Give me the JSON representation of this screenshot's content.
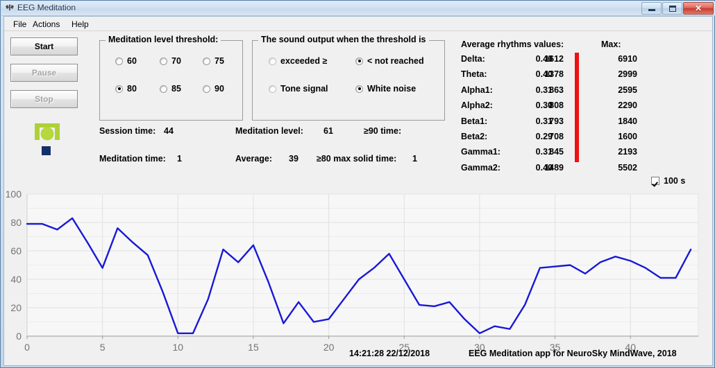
{
  "window": {
    "title": "EEG Meditation",
    "icon": "app-butterfly-icon",
    "buttons": {
      "minimize": "minimize",
      "maximize": "maximize",
      "close": "✕"
    }
  },
  "menu": {
    "items": [
      {
        "label": "File",
        "x": 8
      },
      {
        "label": "Actions",
        "x": 36
      },
      {
        "label": "Help",
        "x": 92
      }
    ]
  },
  "controls": {
    "start": "Start",
    "pause": "Pause",
    "stop": "Stop",
    "start_enabled": true,
    "pause_enabled": false,
    "stop_enabled": false
  },
  "threshold_group": {
    "legend": "Meditation level threshold:",
    "options": [
      {
        "label": "60",
        "selected": false
      },
      {
        "label": "70",
        "selected": false
      },
      {
        "label": "75",
        "selected": false
      },
      {
        "label": "80",
        "selected": true
      },
      {
        "label": "85",
        "selected": false
      },
      {
        "label": "90",
        "selected": false
      }
    ],
    "selected_value": "80"
  },
  "sound_group": {
    "legend": "The sound output when the threshold is",
    "options": [
      {
        "label": "exceeded ≥",
        "selected": false
      },
      {
        "label": "< not reached",
        "selected": true
      },
      {
        "label": "Tone signal",
        "selected": false
      },
      {
        "label": "White noise",
        "selected": true
      }
    ]
  },
  "signal": {
    "headset_icon": "headset-signal-icon",
    "headset_color": "#aed136",
    "status_square_icon": "connection-status-square",
    "status_color": "#14306b"
  },
  "stats": {
    "session_time_label": "Session time:",
    "session_time_value": "44",
    "meditation_time_label": "Meditation time:",
    "meditation_time_value": "1",
    "meditation_level_label": "Meditation level:",
    "meditation_level_value": "61",
    "average_label": "Average:",
    "average_value": "39",
    "ge90_time_label": "≥90 time:",
    "ge90_time_value": "",
    "ge80_solid_label": "≥80 max solid time:",
    "ge80_solid_value": "1"
  },
  "rhythms": {
    "header_avg": "Average rhythms values:",
    "header_max": "Max:",
    "separator_color": "#ee1111",
    "rows": [
      {
        "name": "Delta:",
        "ratio": "0.40",
        "value": "1612",
        "max": "6910"
      },
      {
        "name": "Theta:",
        "ratio": "0.40",
        "value": "1378",
        "max": "2999"
      },
      {
        "name": "Alpha1:",
        "ratio": "0.31",
        "value": "863",
        "max": "2595"
      },
      {
        "name": "Alpha2:",
        "ratio": "0.30",
        "value": "808",
        "max": "2290"
      },
      {
        "name": "Beta1:",
        "ratio": "0.31",
        "value": "793",
        "max": "1840"
      },
      {
        "name": "Beta2:",
        "ratio": "0.29",
        "value": "708",
        "max": "1600"
      },
      {
        "name": "Gamma1:",
        "ratio": "0.31",
        "value": "845",
        "max": "2193"
      },
      {
        "name": "Gamma2:",
        "ratio": "0.40",
        "value": "1489",
        "max": "5502"
      }
    ]
  },
  "window_checkbox": {
    "label": "100 s",
    "checked": true
  },
  "footer": {
    "timestamp": "14:21:28  22/12/2018",
    "credit": "EEG Meditation app for NeuroSky MindWave, 2018"
  },
  "chart_data": {
    "type": "line",
    "title": "",
    "xlabel": "",
    "ylabel": "",
    "xlim": [
      0,
      44.5
    ],
    "ylim": [
      0,
      100
    ],
    "grid": true,
    "legend": null,
    "line_color": "#1818d8",
    "xticks": [
      0,
      5,
      10,
      15,
      20,
      25,
      30,
      35,
      40
    ],
    "yticks": [
      0,
      20,
      40,
      60,
      80,
      100
    ],
    "series": [
      {
        "name": "Meditation level",
        "x": [
          0,
          1,
          2,
          3,
          4,
          5,
          6,
          7,
          8,
          9,
          10,
          11,
          12,
          13,
          14,
          15,
          16,
          17,
          18,
          19,
          20,
          21,
          22,
          23,
          24,
          25,
          26,
          27,
          28,
          29,
          30,
          31,
          32,
          33,
          34,
          35,
          36,
          37,
          38,
          39,
          40,
          41,
          42,
          43,
          44
        ],
        "values": [
          79,
          79,
          75,
          83,
          66,
          48,
          76,
          66,
          57,
          31,
          2,
          2,
          26,
          61,
          52,
          64,
          38,
          9,
          24,
          10,
          12,
          26,
          40,
          48,
          58,
          40,
          22,
          21,
          24,
          12,
          2,
          7,
          5,
          22,
          48,
          49,
          50,
          44,
          52,
          56,
          53,
          48,
          41,
          41,
          61
        ]
      }
    ]
  }
}
